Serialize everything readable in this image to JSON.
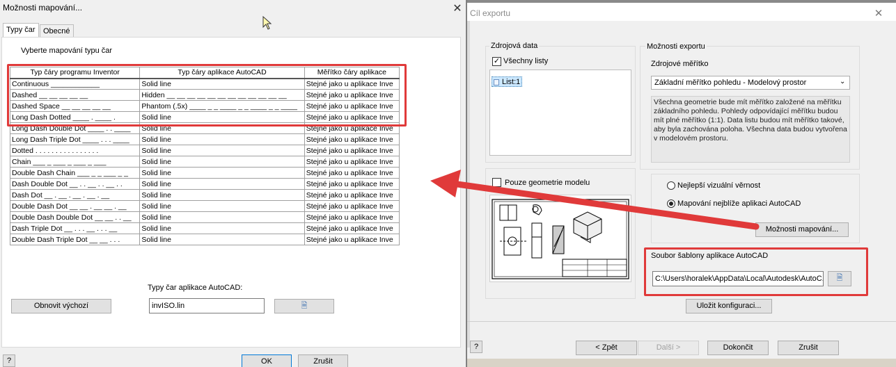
{
  "right_window": {
    "title": "Cíl exportu",
    "close": "✕",
    "source_data": {
      "group_title": "Zdrojová data",
      "all_sheets_label": "Všechny listy",
      "all_sheets_checked": "✓",
      "sheet_item": "List:1"
    },
    "model_geometry_only_label": "Pouze geometrie modelu",
    "export_options": {
      "group_title": "Možnosti exportu",
      "source_scale_label": "Zdrojové měřítko",
      "scale_dropdown_value": "Základní měřítko pohledu - Modelový prostor",
      "description": "Všechna geometrie bude mít měřítko založené na měřítku základního pohledu. Pohledy odpovídající měřítku budou mít plné měřítko (1:1). Data listu budou mít měřítko takové, aby byla zachována poloha. Všechna data budou vytvořena v modelovém prostoru.",
      "radio_best_visual": "Nejlepší vizuální věrnost",
      "radio_mapping": "Mapování nejblíže aplikaci AutoCAD",
      "mapping_options_button": "Možnosti mapování..."
    },
    "template": {
      "group_title": "Soubor šablony aplikace AutoCAD",
      "path_value": "C:\\Users\\horalek\\AppData\\Local\\Autodesk\\AutoC..."
    },
    "save_config_button": "Uložit konfiguraci...",
    "footer": {
      "help": "?",
      "back": "< Zpět",
      "next": "Další >",
      "finish": "Dokončit",
      "cancel": "Zrušit"
    }
  },
  "left_window": {
    "title": "Možnosti mapování...",
    "close": "✕",
    "tabs": [
      "Typy čar",
      "Obecné"
    ],
    "instruction": "Vyberte mapování typu čar",
    "columns": [
      "Typ čáry programu Inventor",
      "Typ čáry aplikace AutoCAD",
      "Měřítko čáry aplikace"
    ],
    "rows": [
      [
        "Continuous ____________",
        "Solid line",
        "Stejné jako u aplikace Inve"
      ],
      [
        "Dashed __ __ __ __ __",
        "Hidden __ __ __ __ __ __ __ __ __ __ __ __",
        "Stejné jako u aplikace Inve"
      ],
      [
        "Dashed Space __ __ __ __ __",
        "Phantom (.5x) ____ _ _ ____ _ _ ____ _ _ ____",
        "Stejné jako u aplikace Inve"
      ],
      [
        "Long Dash Dotted ____ . ____ .",
        "Solid line",
        "Stejné jako u aplikace Inve"
      ],
      [
        "Long Dash Double Dot ____ . . ____",
        "Solid line",
        "Stejné jako u aplikace Inve"
      ],
      [
        "Long Dash Triple Dot ____ . . . ____",
        "Solid line",
        "Stejné jako u aplikace Inve"
      ],
      [
        "Dotted . . . . . . . . . . . . . . . .",
        "Solid line",
        "Stejné jako u aplikace Inve"
      ],
      [
        "Chain ___ _ ___ _ ___ _ ___",
        "Solid line",
        "Stejné jako u aplikace Inve"
      ],
      [
        "Double Dash Chain ___ _ _ ___ _ _",
        "Solid line",
        "Stejné jako u aplikace Inve"
      ],
      [
        "Dash Double Dot __ . . __ . . __ . .",
        "Solid line",
        "Stejné jako u aplikace Inve"
      ],
      [
        "Dash Dot __ . __ . __ . __ . __",
        "Solid line",
        "Stejné jako u aplikace Inve"
      ],
      [
        "Double Dash Dot __ __ . __ __ . __",
        "Solid line",
        "Stejné jako u aplikace Inve"
      ],
      [
        "Double Dash Double Dot __ __ . . __",
        "Solid line",
        "Stejné jako u aplikace Inve"
      ],
      [
        "Dash Triple Dot __ . . . __ . . . __",
        "Solid line",
        "Stejné jako u aplikace Inve"
      ],
      [
        "Double Dash Triple Dot __ __ . . .",
        "Solid line",
        "Stejné jako u aplikace Inve"
      ]
    ],
    "acad_linetypes_label": "Typy čar aplikace AutoCAD:",
    "restore_defaults_button": "Obnovit výchozí",
    "linetype_file_value": "invISO.lin",
    "ok_button": "OK",
    "cancel_button": "Zrušit",
    "help": "?"
  },
  "colors": {
    "highlight_red": "#e03a3a",
    "window_bg": "#f0f0f0",
    "selection_blue": "#cce8ff"
  }
}
